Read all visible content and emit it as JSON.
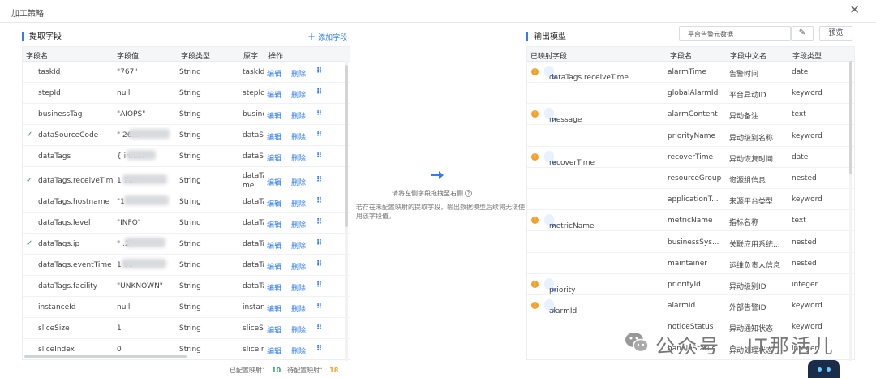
{
  "dialog": {
    "title": "加工策略",
    "close_icon": "close-icon"
  },
  "left": {
    "title": "提取字段",
    "add_label": "添加字段",
    "columns": [
      "字段名",
      "字段值",
      "字段类型",
      "原字",
      "操作"
    ],
    "edit_label": "编辑",
    "delete_label": "删除",
    "rows": [
      {
        "name": "taskId",
        "value": "\"767\"",
        "type": "String",
        "orig": "taskId",
        "checked": false
      },
      {
        "name": "stepId",
        "value": "null",
        "type": "String",
        "orig": "stepIc",
        "checked": false
      },
      {
        "name": "businessTag",
        "value": "\"AIOPS\"",
        "type": "String",
        "orig": "busine",
        "checked": false
      },
      {
        "name": "dataSourceCode",
        "value": "\"        26...",
        "type": "String",
        "orig": "dataS",
        "checked": true
      },
      {
        "name": "dataTags",
        "value": "{          ime...",
        "type": "String",
        "orig": "dataS",
        "checked": false
      },
      {
        "name": "dataTags.receiveTime",
        "value": "1           787",
        "type": "String",
        "orig": "dataTa me",
        "checked": true
      },
      {
        "name": "dataTags.hostname",
        "value": "\"1",
        "type": "String",
        "orig": "dataTa",
        "checked": false
      },
      {
        "name": "dataTags.level",
        "value": "\"INFO\"",
        "type": "String",
        "orig": "dataTa",
        "checked": false
      },
      {
        "name": "dataTags.ip",
        "value": "\"           .2\"",
        "type": "String",
        "orig": "dataTa",
        "checked": true
      },
      {
        "name": "dataTags.eventTime",
        "value": "1             00",
        "type": "String",
        "orig": "dataTa",
        "checked": false
      },
      {
        "name": "dataTags.facility",
        "value": "\"UNKNOWN\"",
        "type": "String",
        "orig": "dataTa",
        "checked": false
      },
      {
        "name": "instanceId",
        "value": "null",
        "type": "String",
        "orig": "instan",
        "checked": false
      },
      {
        "name": "sliceSize",
        "value": "1",
        "type": "String",
        "orig": "sliceS",
        "checked": false
      },
      {
        "name": "sliceIndex",
        "value": "0",
        "type": "String",
        "orig": "sliceIr",
        "checked": false
      }
    ]
  },
  "middle": {
    "hint_main": "请将左侧字段拖拽至右侧",
    "hint_warning": "若存在未配置映射的提取字段，输出数据模型后续将无法使用该字段值。"
  },
  "right": {
    "title": "输出模型",
    "search_value": "平台告警元数据",
    "preview_label": "预览",
    "columns": [
      "已映射字段",
      "字段名",
      "字段中文名",
      "字段类型"
    ],
    "rows": [
      {
        "mapped": "dataTags.receiveTime",
        "name": "alarmTime",
        "cn": "告警时间",
        "type": "date"
      },
      {
        "mapped": "",
        "name": "globalAlarmId",
        "cn": "平台异动ID",
        "type": "keyword"
      },
      {
        "mapped": "message",
        "name": "alarmContent",
        "cn": "异动备注",
        "type": "text"
      },
      {
        "mapped": "",
        "name": "priorityName",
        "cn": "异动级别名称",
        "type": "keyword"
      },
      {
        "mapped": "recoverTime",
        "name": "recoverTime",
        "cn": "异动恢复时间",
        "type": "date"
      },
      {
        "mapped": "",
        "name": "resourceGroup",
        "cn": "资源组信息",
        "type": "nested"
      },
      {
        "mapped": "",
        "name": "applicationT...",
        "cn": "来源平台类型",
        "type": "keyword"
      },
      {
        "mapped": "metricName",
        "name": "metricName",
        "cn": "指标名称",
        "type": "text"
      },
      {
        "mapped": "",
        "name": "businessSys...",
        "cn": "关联应用系统...",
        "type": "nested"
      },
      {
        "mapped": "",
        "name": "maintainer",
        "cn": "运维负责人信息",
        "type": "nested"
      },
      {
        "mapped": "priority",
        "name": "priorityId",
        "cn": "异动级别ID",
        "type": "integer"
      },
      {
        "mapped": "alarmId",
        "name": "alarmId",
        "cn": "外部告警ID",
        "type": "keyword"
      },
      {
        "mapped": "",
        "name": "noticeStatus",
        "cn": "异动通知状态",
        "type": "keyword"
      },
      {
        "mapped": "",
        "name": "handleStatus",
        "cn": "异动处理状态",
        "type": "integer"
      }
    ]
  },
  "footer": {
    "mapped_label": "已配置映射：",
    "mapped_count": "10",
    "pending_label": "待配置映射：",
    "pending_count": "18"
  },
  "watermark": {
    "text": "公众号 · IT那活儿"
  },
  "colors": {
    "accent": "#2f7cf6",
    "check": "#29a36a",
    "warn": "#f4a12a",
    "tag_bg": "#e8f1fd"
  }
}
